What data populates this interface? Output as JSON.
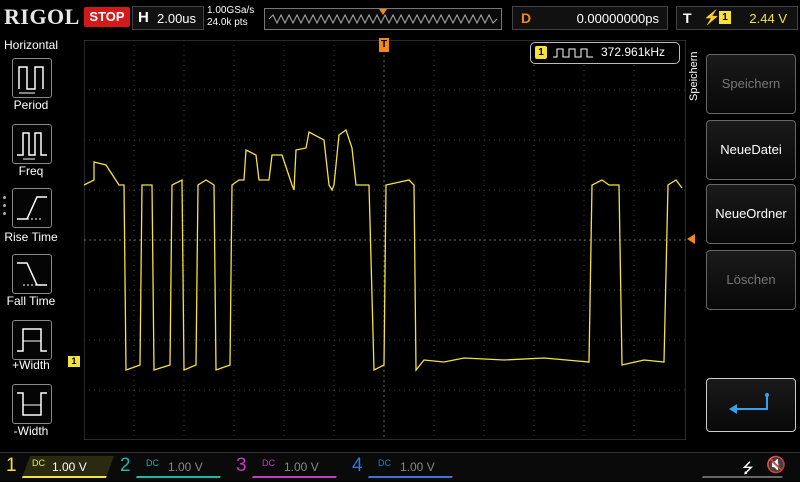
{
  "header": {
    "logo": "RIGOL",
    "run_state": "STOP",
    "horizontal": {
      "label": "H",
      "value": "2.00us"
    },
    "sample_rate": "1.00GSa/s",
    "memory_points": "24.0k pts",
    "delay": {
      "label": "D",
      "value": "0.00000000ps"
    },
    "trigger": {
      "label": "T",
      "edge_icon": "rising-edge-icon",
      "source": "1",
      "level": "2.44 V"
    }
  },
  "left_menu": {
    "title": "Horizontal",
    "items": [
      {
        "label": "Period",
        "icon": "period-icon"
      },
      {
        "label": "Freq",
        "icon": "freq-icon"
      },
      {
        "label": "Rise Time",
        "icon": "rise-time-icon"
      },
      {
        "label": "Fall Time",
        "icon": "fall-time-icon"
      },
      {
        "label": "+Width",
        "icon": "positive-width-icon"
      },
      {
        "label": "-Width",
        "icon": "negative-width-icon"
      }
    ]
  },
  "right_menu": {
    "title": "Speichern",
    "items": [
      {
        "label": "Speichern",
        "state": "disabled"
      },
      {
        "label": "NeueDatei",
        "state": "enabled"
      },
      {
        "label": "NeueOrdner",
        "state": "enabled"
      },
      {
        "label": "Löschen",
        "state": "disabled"
      },
      {
        "label": "",
        "icon": "return-arrow-icon",
        "state": "enabled"
      }
    ]
  },
  "frequency_counter": {
    "channel": "1",
    "value": "372.961kHz"
  },
  "markers": {
    "trigger_position": "T",
    "channel1_offset": "1"
  },
  "channels": [
    {
      "num": "1",
      "coupling": "DC",
      "scale": "1.00 V",
      "color": "#f5e23a",
      "active": true
    },
    {
      "num": "2",
      "coupling": "DC",
      "scale": "1.00 V",
      "color": "#1fb7a6",
      "active": false
    },
    {
      "num": "3",
      "coupling": "DC",
      "scale": "1.00 V",
      "color": "#c33ac3",
      "active": false
    },
    {
      "num": "4",
      "coupling": "DC",
      "scale": "1.00 V",
      "color": "#3a74d6",
      "active": false
    }
  ],
  "status_icons": [
    "usb-icon",
    "speaker-mute-icon"
  ],
  "colors": {
    "trace": "#f5e23a",
    "trigger_marker": "#f08a1c",
    "stop": "#d21a1a"
  }
}
